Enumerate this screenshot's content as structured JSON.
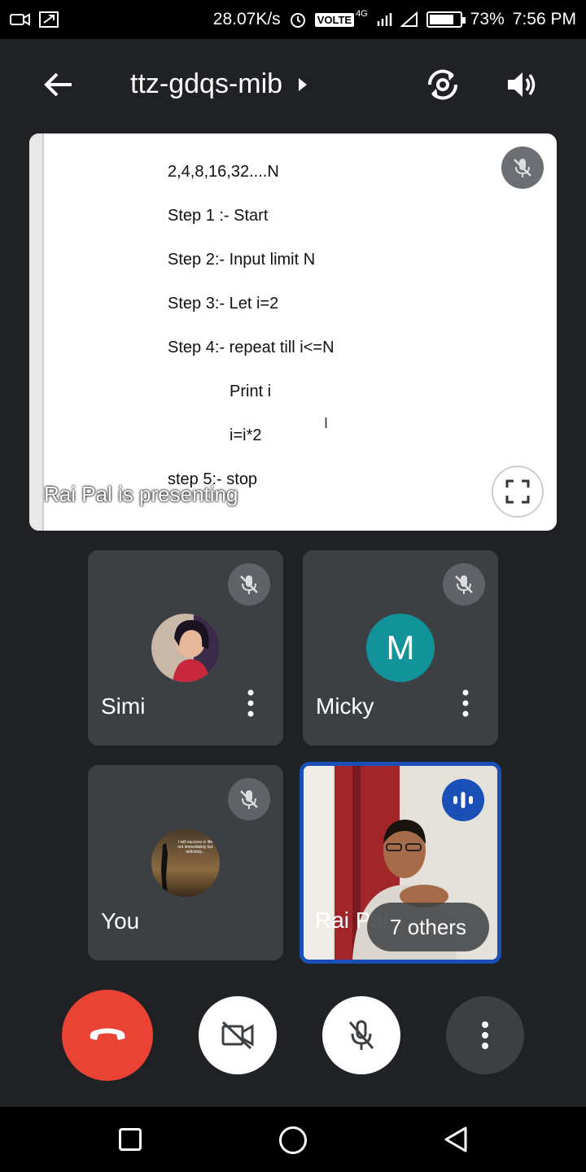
{
  "status_bar": {
    "net_speed": "28.07K/s",
    "volte": "VOLTE",
    "network": "4G",
    "battery": "73%",
    "battery_level": 0.73,
    "time": "7:56 PM"
  },
  "header": {
    "meeting_code": "ttz-gdqs-mib",
    "icons": [
      "back-arrow-icon",
      "chevron-right-icon",
      "switch-camera-icon",
      "speaker-icon"
    ]
  },
  "presentation": {
    "lines": [
      "2,4,8,16,32....N",
      "Step 1 :- Start",
      "Step 2:- Input limit N",
      "Step 3:-  Let i=2",
      "Step 4:- repeat till i<=N",
      "Print i",
      "i=i*2",
      "step 5:- stop"
    ],
    "presenter_label": "Rai Pal is presenting"
  },
  "participants": [
    {
      "name": "Simi",
      "muted": true
    },
    {
      "name": "Micky",
      "initial": "M",
      "muted": true
    },
    {
      "name": "You",
      "avatar_text": "I will success in life not immediately but definitely...",
      "muted": true
    },
    {
      "name": "Rai Pal",
      "speaking": true,
      "overlay": "7 others"
    }
  ],
  "controls": {
    "colors": {
      "end_call": "#ea4335",
      "white_btn": "#ffffff",
      "more_btn": "#3c4043"
    },
    "icons": [
      "end-call-icon",
      "camera-off-icon",
      "mic-off-icon",
      "more-vert-icon"
    ]
  },
  "nav": {
    "icons": [
      "recents-icon",
      "home-icon",
      "back-icon"
    ]
  }
}
